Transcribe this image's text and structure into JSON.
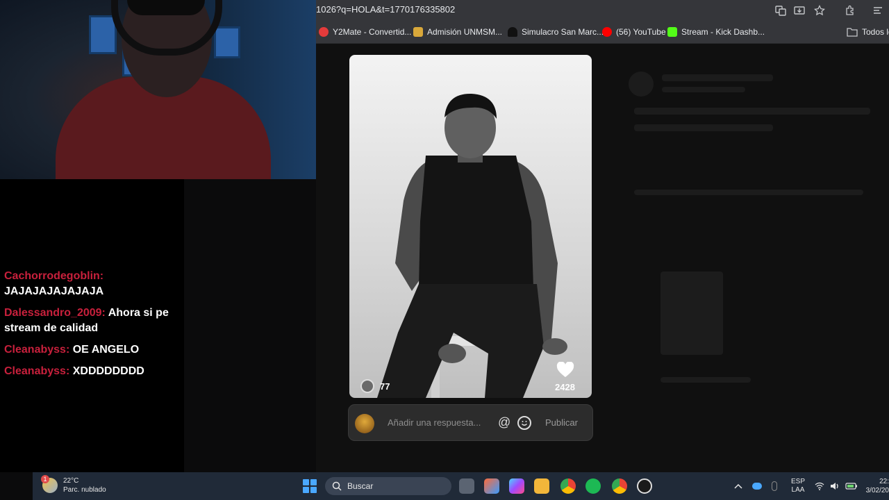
{
  "browser": {
    "url": "1026?q=HOLA&t=1770176335802",
    "bookmarks": [
      {
        "label": "Y2Mate - Convertid...",
        "color": "#e43b3b"
      },
      {
        "label": "Admisión UNMSM...",
        "color": "#d9a83a"
      },
      {
        "label": "Simulacro San Marc...",
        "color": "#111111"
      },
      {
        "label": "(56) YouTube",
        "color": "#ff0000"
      },
      {
        "label": "Stream - Kick Dashb...",
        "color": "#53fc18"
      },
      {
        "label": "Todos lo",
        "color": "#9aa0a6"
      }
    ]
  },
  "chat": {
    "messages": [
      {
        "user": "Cachorrodegoblin:",
        "text": "JAJAJAJAJAJAJA"
      },
      {
        "user": "Dalessandro_2009:",
        "text": "Ahora si pe stream de calidad"
      },
      {
        "user": "Cleanabyss:",
        "text": "OE ANGELO"
      },
      {
        "user": "Cleanabyss:",
        "text": "XDDDDDDDD"
      }
    ],
    "user_color": "#c8203c"
  },
  "post": {
    "reply_count": "77",
    "like_count": "2428"
  },
  "reply_bar": {
    "placeholder": "Añadir una respuesta...",
    "at_symbol": "@",
    "publish_label": "Publicar"
  },
  "taskbar": {
    "weather_badge": "1",
    "temperature": "22°C",
    "weather_desc": "Parc. nublado",
    "search_label": "Buscar",
    "lang_primary": "ESP",
    "lang_secondary": "LAA",
    "time": "22:",
    "date": "3/02/20"
  }
}
